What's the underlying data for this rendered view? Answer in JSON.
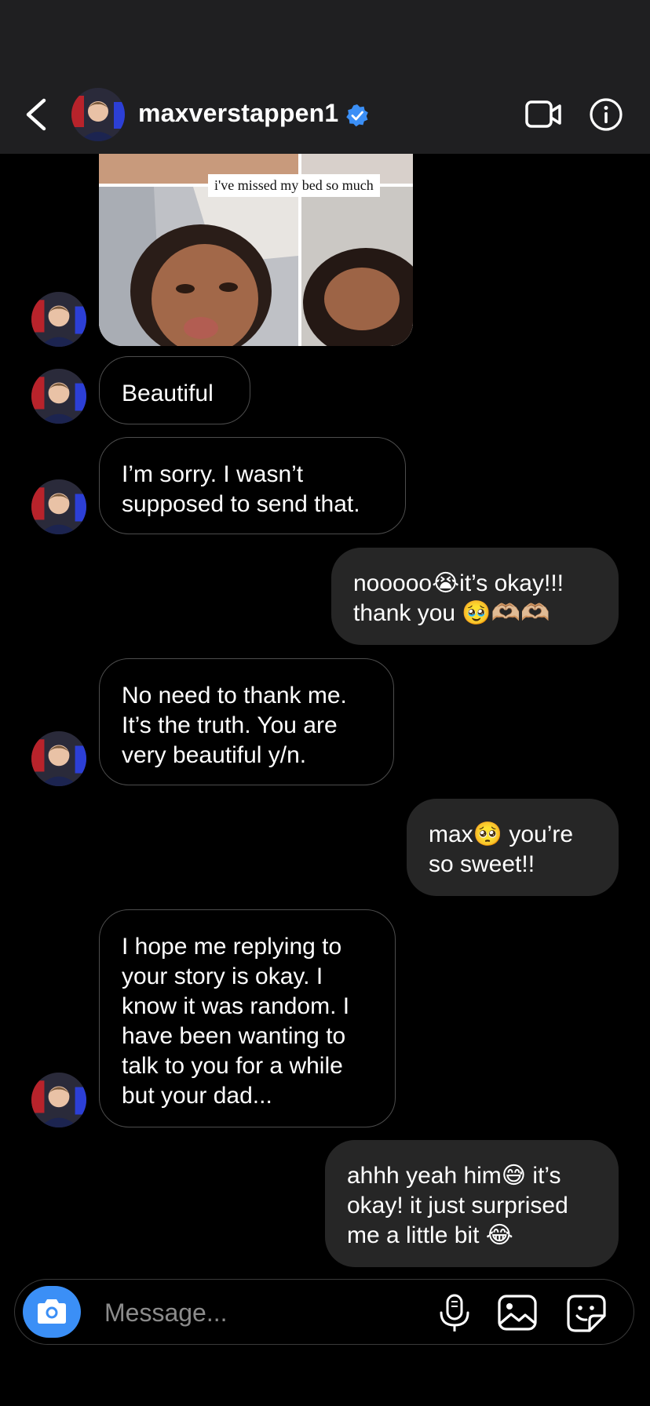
{
  "header": {
    "username": "maxverstappen1",
    "verified": true,
    "icons": [
      "back-arrow-icon",
      "verified-badge-icon",
      "video-call-icon",
      "info-icon"
    ]
  },
  "shared_photo": {
    "caption": "i've missed my bed so much"
  },
  "messages": [
    {
      "direction": "incoming",
      "lines": [
        "Beautiful"
      ]
    },
    {
      "direction": "incoming",
      "lines": [
        "I’m sorry. I wasn’t",
        "supposed to send that."
      ]
    },
    {
      "direction": "outgoing",
      "lines": [
        "nooooo😭it’s okay!!!",
        "thank you 🥹🫶🏼🫶🏼"
      ]
    },
    {
      "direction": "incoming",
      "lines": [
        "No need to thank me.",
        "It’s the truth. You are",
        "very beautiful y/n."
      ]
    },
    {
      "direction": "outgoing",
      "lines": [
        "max🥺 you’re",
        "so sweet!!"
      ]
    },
    {
      "direction": "incoming",
      "lines": [
        "I hope me replying to",
        "your story is okay. I",
        "know it was random. I",
        "have been wanting to",
        "talk to you for a while",
        "but your dad..."
      ]
    },
    {
      "direction": "outgoing",
      "lines": [
        "ahhh yeah him😅 it’s",
        "okay! it just surprised",
        "me a little bit 😂"
      ]
    }
  ],
  "composer": {
    "placeholder": "Message..."
  },
  "colors": {
    "header_bg": "#1f1f21",
    "outgoing_bubble": "#262626",
    "camera_button": "#3b8ff6",
    "verified_badge": "#3b8ff6"
  }
}
